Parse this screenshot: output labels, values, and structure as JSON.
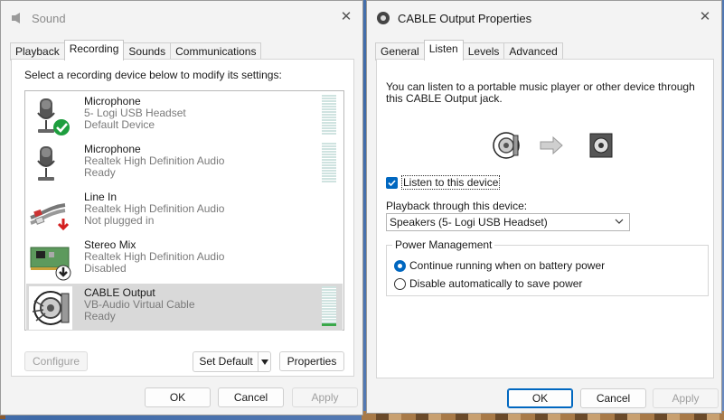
{
  "sound_window": {
    "title": "Sound",
    "tabs": [
      {
        "label": "Playback"
      },
      {
        "label": "Recording"
      },
      {
        "label": "Sounds"
      },
      {
        "label": "Communications"
      }
    ],
    "instruction": "Select a recording device below to modify its settings:",
    "devices": [
      {
        "name": "Microphone",
        "driver": "5- Logi USB Headset",
        "status": "Default Device",
        "icon": "microphone-icon",
        "badge": "default-check-icon"
      },
      {
        "name": "Microphone",
        "driver": "Realtek High Definition Audio",
        "status": "Ready",
        "icon": "microphone-icon"
      },
      {
        "name": "Line In",
        "driver": "Realtek High Definition Audio",
        "status": "Not plugged in",
        "icon": "line-in-cable-icon",
        "badge": "unplugged-arrow-icon"
      },
      {
        "name": "Stereo Mix",
        "driver": "Realtek High Definition Audio",
        "status": "Disabled",
        "icon": "sound-card-icon",
        "badge": "disabled-arrow-icon"
      },
      {
        "name": "CABLE Output",
        "driver": "VB-Audio Virtual Cable",
        "status": "Ready",
        "icon": "virtual-cable-icon",
        "selected": true
      }
    ],
    "buttons": {
      "configure": "Configure",
      "set_default": "Set Default",
      "properties": "Properties",
      "ok": "OK",
      "cancel": "Cancel",
      "apply": "Apply"
    }
  },
  "props_window": {
    "title": "CABLE Output Properties",
    "tabs": [
      {
        "label": "General"
      },
      {
        "label": "Listen"
      },
      {
        "label": "Levels"
      },
      {
        "label": "Advanced"
      }
    ],
    "description": "You can listen to a portable music player or other device through this CABLE Output jack.",
    "listen_checkbox": {
      "label": "Listen to this device",
      "checked": true
    },
    "playback_label": "Playback through this device:",
    "playback_device": "Speakers (5- Logi USB Headset)",
    "power_management": {
      "title": "Power Management",
      "options": [
        {
          "label": "Continue running when on battery power",
          "selected": true
        },
        {
          "label": "Disable automatically to save power",
          "selected": false
        }
      ]
    },
    "buttons": {
      "ok": "OK",
      "cancel": "Cancel",
      "apply": "Apply"
    }
  },
  "colors": {
    "accent": "#0067c0",
    "selection": "#d9d9d9",
    "meter_green": "#3aa84a",
    "default_badge": "#1e9e3e",
    "unplugged_badge": "#d42020"
  }
}
